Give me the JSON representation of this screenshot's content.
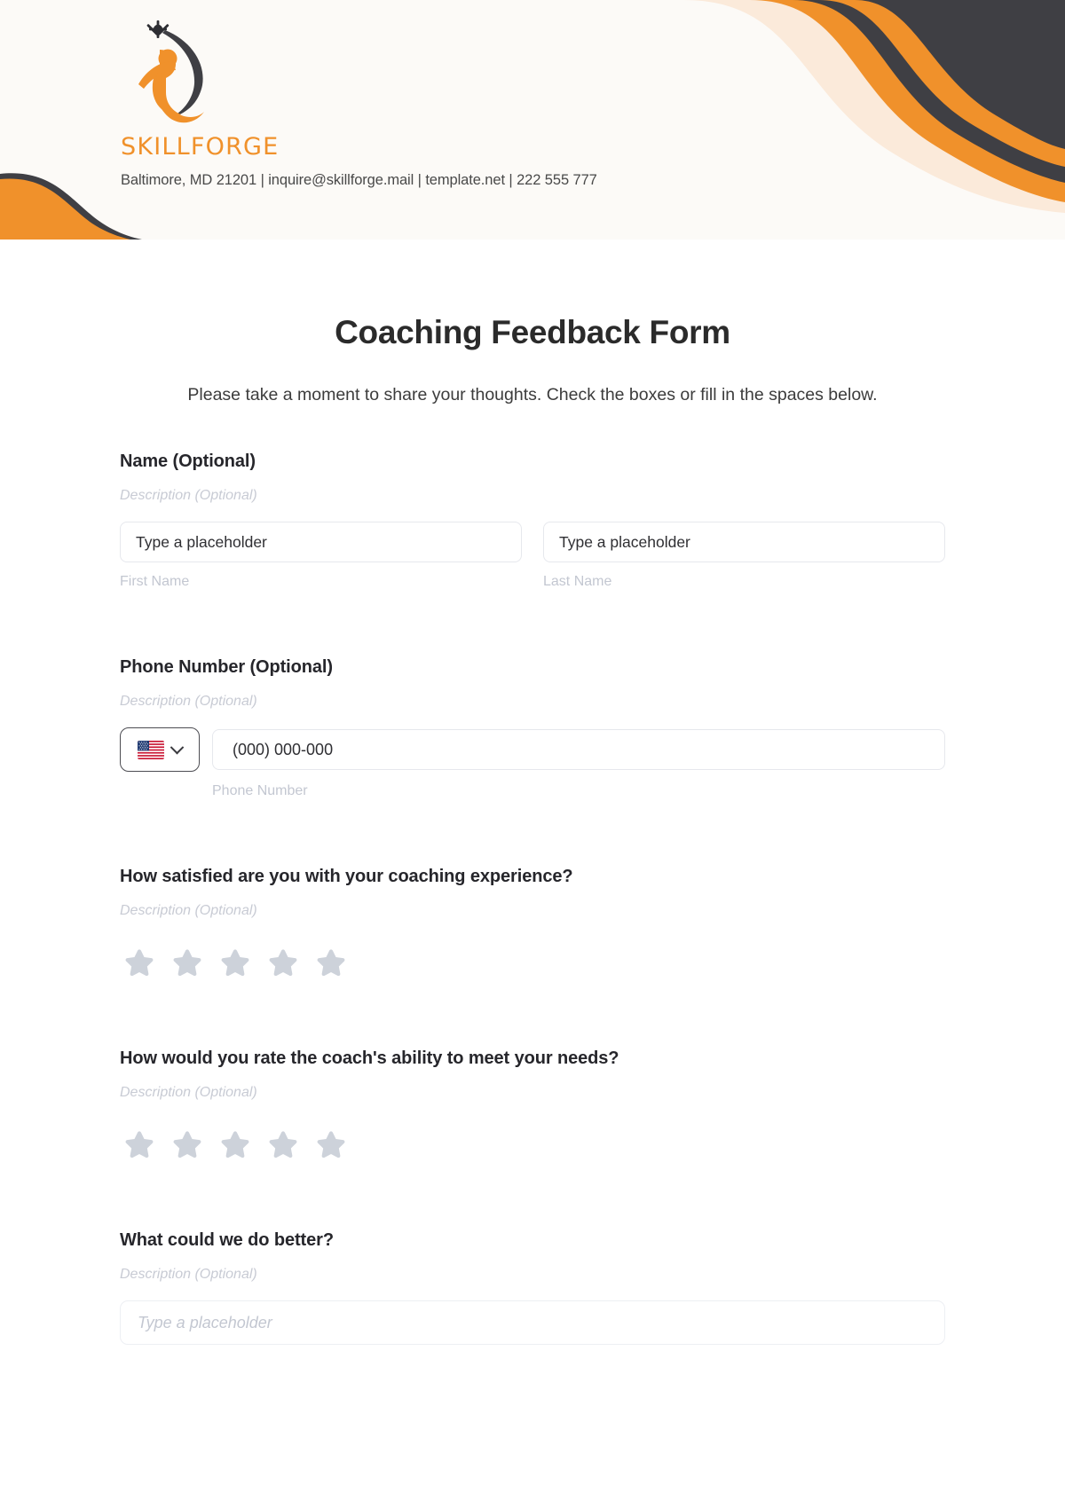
{
  "header": {
    "brand_name": "SKILLFORGE",
    "contact_line": "Baltimore, MD 21201 | inquire@skillforge.mail | template.net | 222 555 777",
    "logo_icon": "person-swoosh-star-logo",
    "colors": {
      "orange": "#F0912B",
      "dark": "#3F3F44",
      "cream": "#FBEADA",
      "background": "#FCFAF7"
    }
  },
  "form": {
    "title": "Coaching Feedback Form",
    "subtitle": "Please take a moment to share your thoughts. Check the boxes or fill in the spaces below.",
    "sections": [
      {
        "label": "Name (Optional)",
        "description": "Description (Optional)",
        "first_name": {
          "placeholder": "Type a placeholder",
          "sub_label": "First Name"
        },
        "last_name": {
          "placeholder": "Type a placeholder",
          "sub_label": "Last Name"
        }
      },
      {
        "label": "Phone Number (Optional)",
        "description": "Description (Optional)",
        "country_flag": "us-flag-icon",
        "chevron": "chevron-down-icon",
        "placeholder": "(000) 000-000",
        "sub_label": "Phone Number"
      },
      {
        "label": "How satisfied are you with your coaching experience?",
        "description": "Description (Optional)",
        "rating_icon": "star-icon",
        "star_count": 5,
        "selected": 0
      },
      {
        "label": "How would you rate the coach's ability to meet your needs?",
        "description": "Description (Optional)",
        "rating_icon": "star-icon",
        "star_count": 5,
        "selected": 0
      },
      {
        "label": "What could we do better?",
        "description": "Description (Optional)",
        "placeholder": "Type a placeholder"
      }
    ]
  }
}
